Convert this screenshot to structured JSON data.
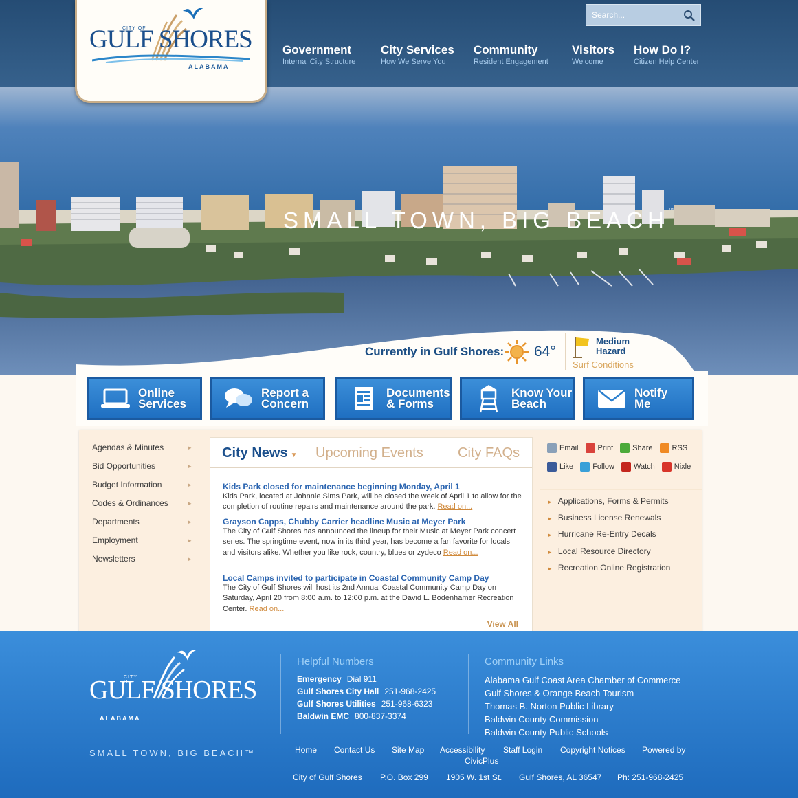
{
  "colors": {
    "header_bg": "#2a5480",
    "brand_blue": "#1b4f8c",
    "button_blue": "#2a7fce",
    "accent_gold": "#d08a3c",
    "footer_bg": "#2b7dcc",
    "content_bg": "#fcefe0"
  },
  "logo": {
    "city": "CITY OF",
    "name": "GULF SHORES",
    "state": "ALABAMA",
    "tm": "™"
  },
  "search": {
    "placeholder": "Search...",
    "icon": "search-icon"
  },
  "nav": [
    {
      "title": "Government",
      "sub": "Internal City Structure"
    },
    {
      "title": "City Services",
      "sub": "How We Serve You"
    },
    {
      "title": "Community",
      "sub": "Resident Engagement"
    },
    {
      "title": "Visitors",
      "sub": "Welcome"
    },
    {
      "title": "How Do I?",
      "sub": "Citizen Help Center"
    }
  ],
  "hero": {
    "tagline": "SMALL TOWN, BIG BEACH",
    "tm": "™"
  },
  "weather": {
    "label": "Currently in Gulf Shores:",
    "icon": "sun-icon",
    "temp": "64°",
    "surf_level_line1": "Medium",
    "surf_level_line2": "Hazard",
    "surf_label": "Surf Conditions",
    "surf_icon": "yellow-flag-icon"
  },
  "quick_links": [
    {
      "line1": "Online",
      "line2": "Services",
      "icon": "laptop-icon"
    },
    {
      "line1": "Report a",
      "line2": "Concern",
      "icon": "speech-bubbles-icon"
    },
    {
      "line1": "Documents",
      "line2": "& Forms",
      "icon": "document-icon"
    },
    {
      "line1": "Know Your",
      "line2": "Beach",
      "icon": "lifeguard-tower-icon"
    },
    {
      "line1": "Notify",
      "line2": "Me",
      "icon": "envelope-icon"
    }
  ],
  "left_nav": [
    "Agendas & Minutes",
    "Bid Opportunities",
    "Budget Information",
    "Codes & Ordinances",
    "Departments",
    "Employment",
    "Newsletters"
  ],
  "tabs": {
    "news": "City News",
    "events": "Upcoming Events",
    "faqs": "City FAQs"
  },
  "news": [
    {
      "title": "Kids Park closed for maintenance beginning Monday, April 1",
      "body": "Kids Park, located at Johnnie Sims Park, will be closed the week of April 1 to allow for the completion of routine repairs and maintenance around the park.",
      "read": "Read on..."
    },
    {
      "title": "Grayson Capps, Chubby Carrier headline Music at Meyer Park",
      "body": "The City of Gulf Shores has announced the lineup for their Music at Meyer Park concert series. The springtime event, now in its third year, has become a fan favorite for locals and visitors alike. Whether you like rock, country, blues or zydeco",
      "read": "Read on..."
    },
    {
      "title": "Local Camps invited to participate in Coastal Community Camp Day",
      "body": "The City of Gulf Shores will host its 2nd Annual Coastal Community Camp Day on Saturday, April 20 from 8:00 a.m. to 12:00 p.m. at the David L. Bodenhamer Recreation Center.",
      "read": "Read on..."
    }
  ],
  "view_all": "View All",
  "social_row1": [
    {
      "label": "Email",
      "icon": "email-icon",
      "color": "#8aa0b8"
    },
    {
      "label": "Print",
      "icon": "print-icon",
      "color": "#d9433c"
    },
    {
      "label": "Share",
      "icon": "share-icon",
      "color": "#4caa3a"
    },
    {
      "label": "RSS",
      "icon": "rss-icon",
      "color": "#f08a24"
    }
  ],
  "social_row2": [
    {
      "label": "Like",
      "icon": "facebook-icon",
      "color": "#3b5b99"
    },
    {
      "label": "Follow",
      "icon": "twitter-icon",
      "color": "#3aa0d8"
    },
    {
      "label": "Watch",
      "icon": "youtube-icon",
      "color": "#c4261d"
    },
    {
      "label": "Nixle",
      "icon": "nixle-icon",
      "color": "#d8352a"
    }
  ],
  "right_links": [
    "Applications, Forms & Permits",
    "Business License Renewals",
    "Hurricane Re-Entry Decals",
    "Local Resource Directory",
    "Recreation Online Registration"
  ],
  "footer": {
    "tagline": "SMALL TOWN, BIG BEACH™",
    "helpful_heading": "Helpful Numbers",
    "numbers": [
      {
        "label": "Emergency",
        "value": "Dial 911"
      },
      {
        "label": "Gulf Shores City Hall",
        "value": "251-968-2425"
      },
      {
        "label": "Gulf Shores Utilities",
        "value": "251-968-6323"
      },
      {
        "label": "Baldwin EMC",
        "value": "800-837-3374"
      }
    ],
    "community_heading": "Community Links",
    "community_links": [
      "Alabama Gulf Coast Area Chamber of Commerce",
      "Gulf Shores & Orange Beach Tourism",
      "Thomas B. Norton Public Library",
      "Baldwin County Commission",
      "Baldwin County Public Schools"
    ],
    "bottom_links": [
      "Home",
      "Contact Us",
      "Site Map",
      "Accessibility",
      "Staff Login",
      "Copyright Notices",
      "Powered by",
      "CivicPlus"
    ],
    "address": [
      "City of Gulf Shores",
      "P.O. Box 299",
      "1905 W. 1st St.",
      "Gulf Shores, AL 36547",
      "Ph: 251-968-2425"
    ]
  }
}
